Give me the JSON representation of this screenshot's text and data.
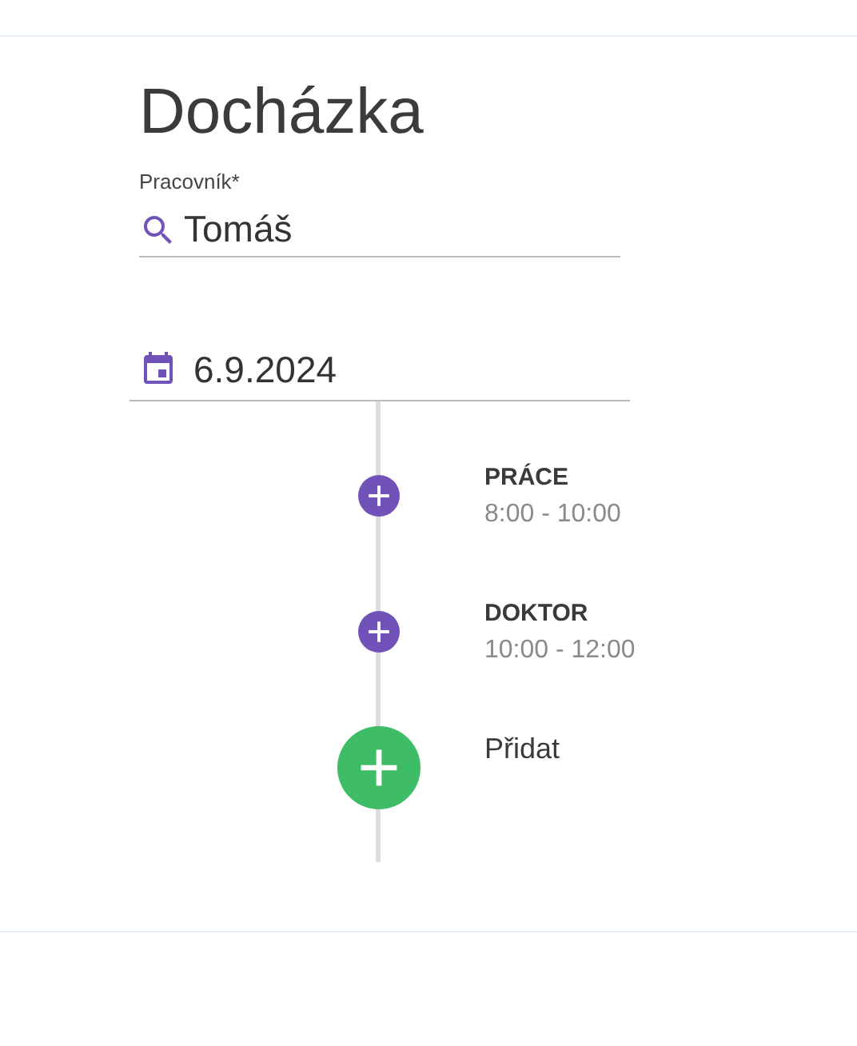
{
  "title": "Docházka",
  "worker_field": {
    "label": "Pracovník*",
    "value": "Tomáš"
  },
  "date_field": {
    "value": "6.9.2024"
  },
  "timeline": [
    {
      "kind": "entry",
      "title": "PRÁCE",
      "time": "8:00 - 10:00"
    },
    {
      "kind": "entry",
      "title": "DOKTOR",
      "time": "10:00 - 12:00"
    },
    {
      "kind": "add",
      "label": "Přidat"
    }
  ]
}
